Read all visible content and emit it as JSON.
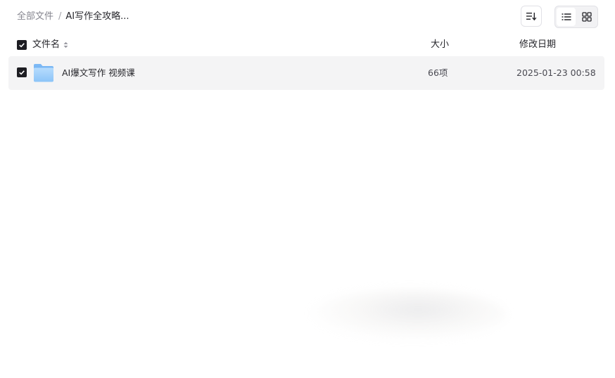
{
  "breadcrumb": {
    "root": "全部文件",
    "separator": "/",
    "current": "AI写作全攻略..."
  },
  "toolbar": {
    "sort_icon": "sort-lines-icon",
    "list_view_icon": "list-view-icon",
    "grid_view_icon": "grid-view-icon",
    "active_view": "list"
  },
  "table": {
    "headers": {
      "name": "文件名",
      "size": "大小",
      "modified": "修改日期"
    },
    "rows": [
      {
        "checked": true,
        "icon": "folder-icon",
        "name": "AI爆文写作 视频课",
        "size": "66项",
        "modified": "2025-01-23 00:58"
      }
    ]
  },
  "colors": {
    "accent_checkbox": "#1d1d22",
    "folder_light": "#a9d3fb",
    "folder_dark": "#5fa8f2",
    "row_selected_bg": "#f4f4f5"
  }
}
